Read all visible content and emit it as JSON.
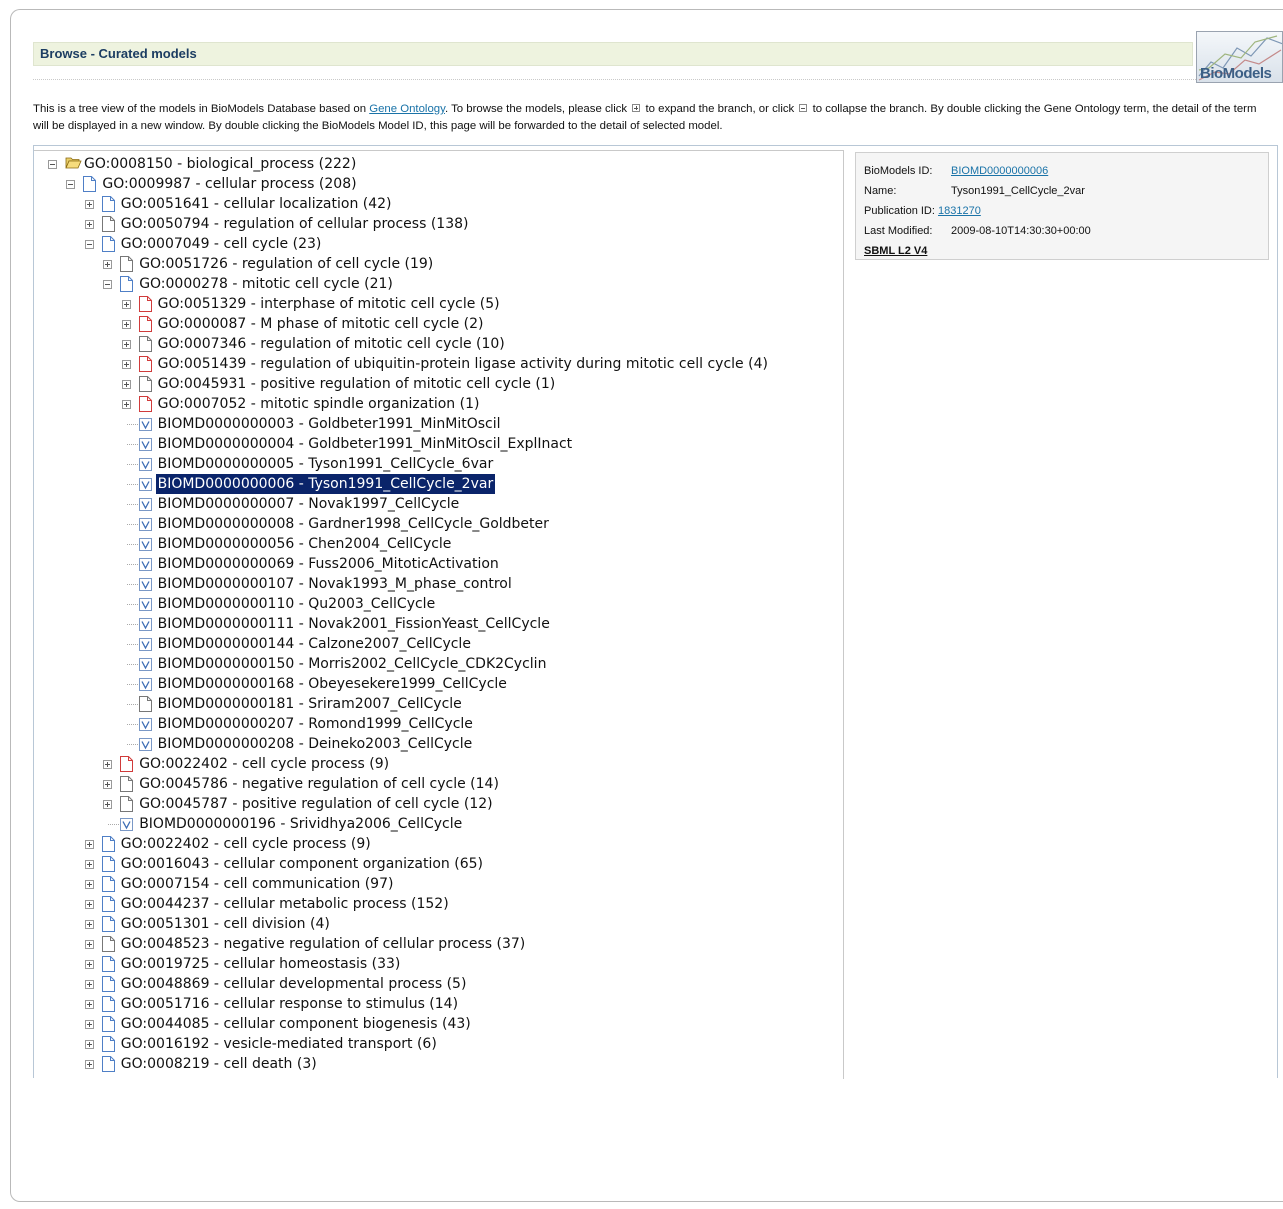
{
  "header": {
    "title": "Browse - Curated models",
    "logo_text": "BioModels"
  },
  "intro": {
    "part1": "This is a tree view of the models in BioModels Database based on ",
    "link": "Gene Ontology",
    "part2": ". To browse the models, please click ",
    "part3": " to expand the branch, or click ",
    "part4": " to collapse the branch. By double clicking the Gene Ontology term, the detail of the term will be displayed in a new window. By double clicking the BioModels Model ID, this page will be forwarded to the detail of selected model."
  },
  "info": {
    "id_label": "BioModels ID:",
    "id_value": "BIOMD0000000006",
    "name_label": "Name:",
    "name_value": "Tyson1991_CellCycle_2var",
    "pub_label": "Publication ID:",
    "pub_value": "1831270",
    "modified_label": "Last Modified:",
    "modified_value": "2009-08-10T14:30:30+00:00",
    "sbml": "SBML L2 V4"
  },
  "tree": [
    {
      "label": "GO:0008150 - biological_process (222)",
      "depth": 0,
      "toggle": "minus",
      "icon": "folder-open"
    },
    {
      "label": "GO:0009987 - cellular process (208)",
      "depth": 1,
      "toggle": "minus",
      "icon": "doc-blue"
    },
    {
      "label": "GO:0051641 - cellular localization (42)",
      "depth": 2,
      "toggle": "plus",
      "icon": "doc-blue"
    },
    {
      "label": "GO:0050794 - regulation of cellular process (138)",
      "depth": 2,
      "toggle": "plus",
      "icon": "doc-white"
    },
    {
      "label": "GO:0007049 - cell cycle (23)",
      "depth": 2,
      "toggle": "minus",
      "icon": "doc-blue"
    },
    {
      "label": "GO:0051726 - regulation of cell cycle (19)",
      "depth": 3,
      "toggle": "plus",
      "icon": "doc-white"
    },
    {
      "label": "GO:0000278 - mitotic cell cycle (21)",
      "depth": 3,
      "toggle": "minus",
      "icon": "doc-blue"
    },
    {
      "label": "GO:0051329 - interphase of mitotic cell cycle (5)",
      "depth": 4,
      "toggle": "plus",
      "icon": "doc-red"
    },
    {
      "label": "GO:0000087 - M phase of mitotic cell cycle (2)",
      "depth": 4,
      "toggle": "plus",
      "icon": "doc-red"
    },
    {
      "label": "GO:0007346 - regulation of mitotic cell cycle (10)",
      "depth": 4,
      "toggle": "plus",
      "icon": "doc-white"
    },
    {
      "label": "GO:0051439 - regulation of ubiquitin-protein ligase activity during mitotic cell cycle (4)",
      "depth": 4,
      "toggle": "plus",
      "icon": "doc-red"
    },
    {
      "label": "GO:0045931 - positive regulation of mitotic cell cycle (1)",
      "depth": 4,
      "toggle": "plus",
      "icon": "doc-white"
    },
    {
      "label": "GO:0007052 - mitotic spindle organization (1)",
      "depth": 4,
      "toggle": "plus",
      "icon": "doc-red"
    },
    {
      "label": "BIOMD0000000003 - Goldbeter1991_MinMitOscil",
      "depth": 4,
      "toggle": "none",
      "icon": "model"
    },
    {
      "label": "BIOMD0000000004 - Goldbeter1991_MinMitOscil_ExplInact",
      "depth": 4,
      "toggle": "none",
      "icon": "model"
    },
    {
      "label": "BIOMD0000000005 - Tyson1991_CellCycle_6var",
      "depth": 4,
      "toggle": "none",
      "icon": "model"
    },
    {
      "label": "BIOMD0000000006 - Tyson1991_CellCycle_2var",
      "depth": 4,
      "toggle": "none",
      "icon": "model",
      "selected": true
    },
    {
      "label": "BIOMD0000000007 - Novak1997_CellCycle",
      "depth": 4,
      "toggle": "none",
      "icon": "model"
    },
    {
      "label": "BIOMD0000000008 - Gardner1998_CellCycle_Goldbeter",
      "depth": 4,
      "toggle": "none",
      "icon": "model"
    },
    {
      "label": "BIOMD0000000056 - Chen2004_CellCycle",
      "depth": 4,
      "toggle": "none",
      "icon": "model"
    },
    {
      "label": "BIOMD0000000069 - Fuss2006_MitoticActivation",
      "depth": 4,
      "toggle": "none",
      "icon": "model"
    },
    {
      "label": "BIOMD0000000107 - Novak1993_M_phase_control",
      "depth": 4,
      "toggle": "none",
      "icon": "model"
    },
    {
      "label": "BIOMD0000000110 - Qu2003_CellCycle",
      "depth": 4,
      "toggle": "none",
      "icon": "model"
    },
    {
      "label": "BIOMD0000000111 - Novak2001_FissionYeast_CellCycle",
      "depth": 4,
      "toggle": "none",
      "icon": "model"
    },
    {
      "label": "BIOMD0000000144 - Calzone2007_CellCycle",
      "depth": 4,
      "toggle": "none",
      "icon": "model"
    },
    {
      "label": "BIOMD0000000150 - Morris2002_CellCycle_CDK2Cyclin",
      "depth": 4,
      "toggle": "none",
      "icon": "model"
    },
    {
      "label": "BIOMD0000000168 - Obeyesekere1999_CellCycle",
      "depth": 4,
      "toggle": "none",
      "icon": "model"
    },
    {
      "label": "BIOMD0000000181 - Sriram2007_CellCycle",
      "depth": 4,
      "toggle": "none",
      "icon": "doc-white"
    },
    {
      "label": "BIOMD0000000207 - Romond1999_CellCycle",
      "depth": 4,
      "toggle": "none",
      "icon": "model"
    },
    {
      "label": "BIOMD0000000208 - Deineko2003_CellCycle",
      "depth": 4,
      "toggle": "none",
      "icon": "model"
    },
    {
      "label": "GO:0022402 - cell cycle process (9)",
      "depth": 3,
      "toggle": "plus",
      "icon": "doc-red"
    },
    {
      "label": "GO:0045786 - negative regulation of cell cycle (14)",
      "depth": 3,
      "toggle": "plus",
      "icon": "doc-white"
    },
    {
      "label": "GO:0045787 - positive regulation of cell cycle (12)",
      "depth": 3,
      "toggle": "plus",
      "icon": "doc-white"
    },
    {
      "label": "BIOMD0000000196 - Srividhya2006_CellCycle",
      "depth": 3,
      "toggle": "none",
      "icon": "model"
    },
    {
      "label": "GO:0022402 - cell cycle process (9)",
      "depth": 2,
      "toggle": "plus",
      "icon": "doc-blue"
    },
    {
      "label": "GO:0016043 - cellular component organization (65)",
      "depth": 2,
      "toggle": "plus",
      "icon": "doc-blue"
    },
    {
      "label": "GO:0007154 - cell communication (97)",
      "depth": 2,
      "toggle": "plus",
      "icon": "doc-blue"
    },
    {
      "label": "GO:0044237 - cellular metabolic process (152)",
      "depth": 2,
      "toggle": "plus",
      "icon": "doc-blue"
    },
    {
      "label": "GO:0051301 - cell division (4)",
      "depth": 2,
      "toggle": "plus",
      "icon": "doc-blue"
    },
    {
      "label": "GO:0048523 - negative regulation of cellular process (37)",
      "depth": 2,
      "toggle": "plus",
      "icon": "doc-white"
    },
    {
      "label": "GO:0019725 - cellular homeostasis (33)",
      "depth": 2,
      "toggle": "plus",
      "icon": "doc-blue"
    },
    {
      "label": "GO:0048869 - cellular developmental process (5)",
      "depth": 2,
      "toggle": "plus",
      "icon": "doc-blue"
    },
    {
      "label": "GO:0051716 - cellular response to stimulus (14)",
      "depth": 2,
      "toggle": "plus",
      "icon": "doc-blue"
    },
    {
      "label": "GO:0044085 - cellular component biogenesis (43)",
      "depth": 2,
      "toggle": "plus",
      "icon": "doc-blue"
    },
    {
      "label": "GO:0016192 - vesicle-mediated transport (6)",
      "depth": 2,
      "toggle": "plus",
      "icon": "doc-blue"
    },
    {
      "label": "GO:0008219 - cell death (3)",
      "depth": 2,
      "toggle": "plus",
      "icon": "doc-blue"
    }
  ]
}
